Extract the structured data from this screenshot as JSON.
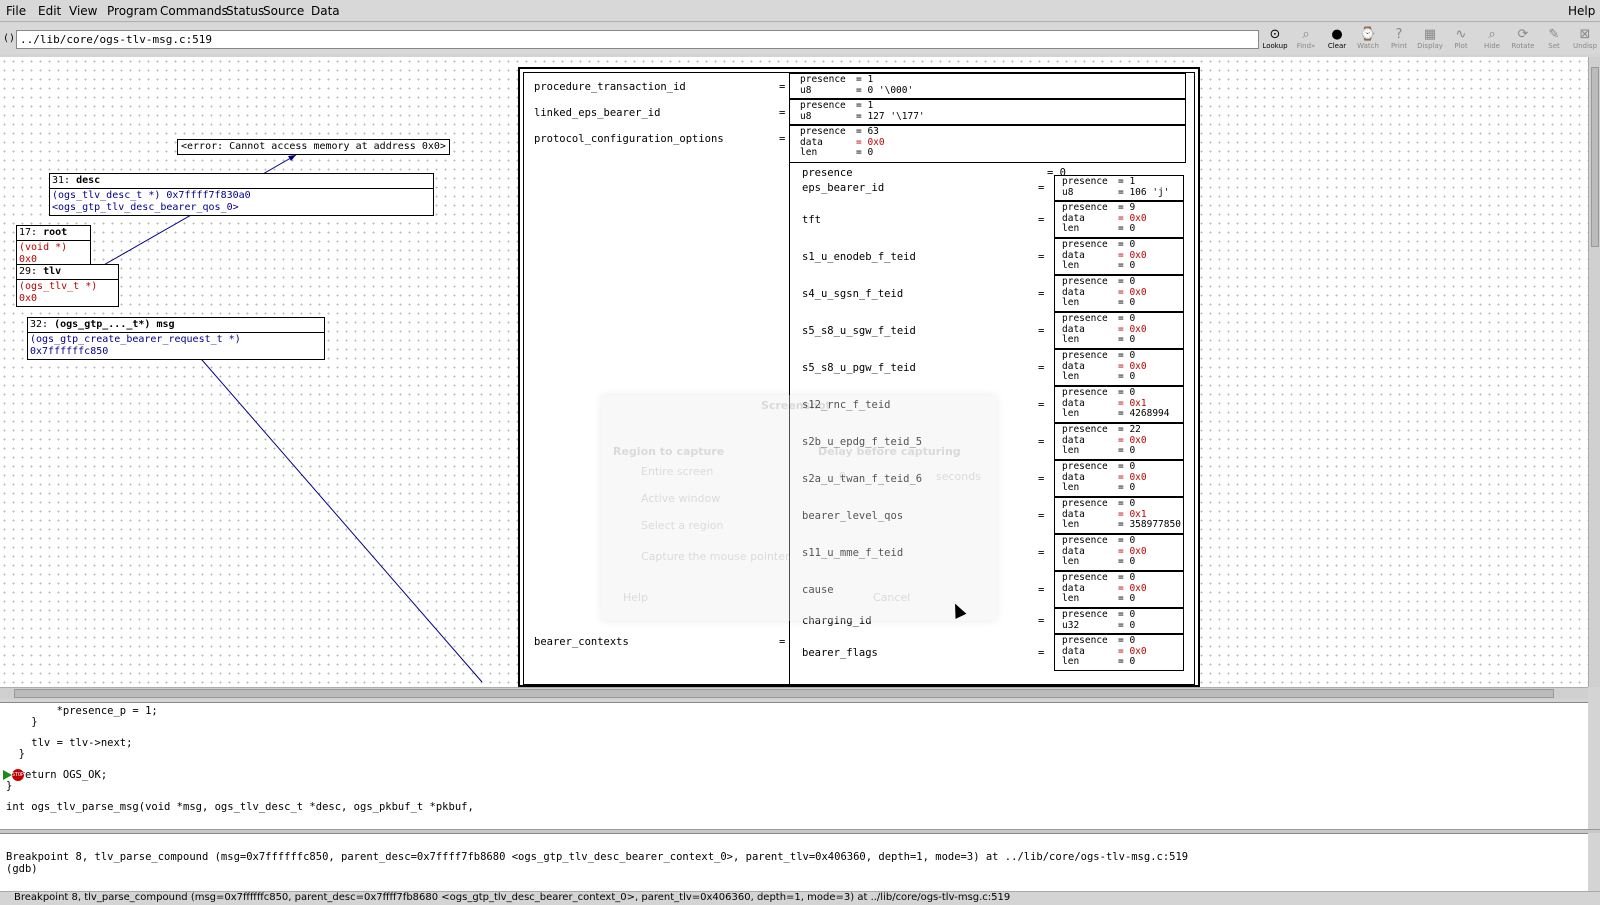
{
  "menu": [
    "File",
    "Edit",
    "View",
    "Program",
    "Commands",
    "Status",
    "Source",
    "Data"
  ],
  "help": "Help",
  "arg_label": "():",
  "arg_value": "../lib/core/ogs-tlv-msg.c:519",
  "toolbar": [
    {
      "label": "Lookup",
      "icon": "lookup-icon",
      "active": true
    },
    {
      "label": "Find»",
      "icon": "find-icon",
      "active": false
    },
    {
      "label": "Clear",
      "icon": "clear-icon",
      "active": true
    },
    {
      "label": "Watch",
      "icon": "watch-icon",
      "active": false
    },
    {
      "label": "Print",
      "icon": "print-icon",
      "active": false
    },
    {
      "label": "Display",
      "icon": "display-icon",
      "active": false
    },
    {
      "label": "Plot",
      "icon": "plot-icon",
      "active": false
    },
    {
      "label": "Hide",
      "icon": "hide-icon",
      "active": false
    },
    {
      "label": "Rotate",
      "icon": "rotate-icon",
      "active": false
    },
    {
      "label": "Set",
      "icon": "set-icon",
      "active": false
    },
    {
      "label": "Undisp",
      "icon": "undisp-icon",
      "active": false
    }
  ],
  "nodes": {
    "error": "<error: Cannot access memory at address 0x0>",
    "desc_hd_num": "31:",
    "desc_hd_name": "desc",
    "desc_val": "(ogs_tlv_desc_t *) 0x7ffff7f830a0 <ogs_gtp_tlv_desc_bearer_qos_0>",
    "root_hd_num": "17:",
    "root_hd_name": "root",
    "root_val": "(void *) 0x0",
    "tlv_hd_num": "29:",
    "tlv_hd_name": "tlv",
    "tlv_val": "(ogs_tlv_t *) 0x0",
    "msg_hd_num": "32:",
    "msg_hd_name": "(ogs_gtp_..._t*) msg",
    "msg_val": "(ogs_gtp_create_bearer_request_t *) 0x7ffffffc850"
  },
  "struct": {
    "top_fields": [
      {
        "name": "procedure_transaction_id",
        "lines": [
          [
            "presence",
            "= 1"
          ],
          [
            "u8",
            "= 0 '\\000'"
          ]
        ]
      },
      {
        "name": "linked_eps_bearer_id",
        "lines": [
          [
            "presence",
            "= 1"
          ],
          [
            "u8",
            "= 127 '\\177'"
          ]
        ]
      },
      {
        "name": "protocol_configuration_options",
        "lines": [
          [
            "presence",
            "= 63"
          ],
          [
            "data",
            "= 0x0"
          ],
          [
            "len",
            "= 0"
          ]
        ]
      }
    ],
    "bearer_label": "bearer_contexts",
    "eq": "=",
    "presence_label": "presence",
    "presence_val": "= 0",
    "sub": [
      {
        "name": "eps_bearer_id",
        "lines": [
          [
            "presence",
            "= 1"
          ],
          [
            "u8",
            "= 106 'j'"
          ]
        ]
      },
      {
        "name": "tft",
        "lines": [
          [
            "presence",
            "= 9"
          ],
          [
            "data",
            "= 0x0"
          ],
          [
            "len",
            "= 0"
          ]
        ]
      },
      {
        "name": "s1_u_enodeb_f_teid",
        "lines": [
          [
            "presence",
            "= 0"
          ],
          [
            "data",
            "= 0x0"
          ],
          [
            "len",
            "= 0"
          ]
        ]
      },
      {
        "name": "s4_u_sgsn_f_teid",
        "lines": [
          [
            "presence",
            "= 0"
          ],
          [
            "data",
            "= 0x0"
          ],
          [
            "len",
            "= 0"
          ]
        ]
      },
      {
        "name": "s5_s8_u_sgw_f_teid",
        "lines": [
          [
            "presence",
            "= 0"
          ],
          [
            "data",
            "= 0x0"
          ],
          [
            "len",
            "= 0"
          ]
        ]
      },
      {
        "name": "s5_s8_u_pgw_f_teid",
        "lines": [
          [
            "presence",
            "= 0"
          ],
          [
            "data",
            "= 0x0"
          ],
          [
            "len",
            "= 0"
          ]
        ]
      },
      {
        "name": "s12_rnc_f_teid",
        "lines": [
          [
            "presence",
            "= 0"
          ],
          [
            "data",
            "= 0x1"
          ],
          [
            "len",
            "= 4268994"
          ]
        ]
      },
      {
        "name": "s2b_u_epdg_f_teid_5",
        "lines": [
          [
            "presence",
            "= 22"
          ],
          [
            "data",
            "= 0x0"
          ],
          [
            "len",
            "= 0"
          ]
        ]
      },
      {
        "name": "s2a_u_twan_f_teid_6",
        "lines": [
          [
            "presence",
            "= 0"
          ],
          [
            "data",
            "= 0x0"
          ],
          [
            "len",
            "= 0"
          ]
        ]
      },
      {
        "name": "bearer_level_qos",
        "lines": [
          [
            "presence",
            "= 0"
          ],
          [
            "data",
            "= 0x1"
          ],
          [
            "len",
            "= 358977850"
          ]
        ]
      },
      {
        "name": "s11_u_mme_f_teid",
        "lines": [
          [
            "presence",
            "= 0"
          ],
          [
            "data",
            "= 0x0"
          ],
          [
            "len",
            "= 0"
          ]
        ]
      },
      {
        "name": "cause",
        "lines": [
          [
            "presence",
            "= 0"
          ],
          [
            "data",
            "= 0x0"
          ],
          [
            "len",
            "= 0"
          ]
        ]
      },
      {
        "name": "charging_id",
        "lines": [
          [
            "presence",
            "= 0"
          ],
          [
            "u32",
            "= 0"
          ]
        ]
      },
      {
        "name": "bearer_flags",
        "lines": [
          [
            "presence",
            "= 0"
          ],
          [
            "data",
            "= 0x0"
          ],
          [
            "len",
            "= 0"
          ]
        ]
      }
    ]
  },
  "ghost": {
    "title": "Screenshot",
    "region": "Region to capture",
    "entire": "Entire screen",
    "active": "Active window",
    "select": "Select a region",
    "capture": "Capture the mouse pointer",
    "delay": "Delay before capturing",
    "seconds": "seconds",
    "delay_val": "0",
    "help": "Help",
    "cancel": "Cancel"
  },
  "source": [
    "        *presence_p = 1;",
    "    }",
    "",
    "    tlv = tlv->next;",
    "  }",
    "",
    "  return OGS_OK;",
    "}",
    "",
    "int ogs_tlv_parse_msg(void *msg, ogs_tlv_desc_t *desc, ogs_pkbuf_t *pkbuf,"
  ],
  "console": [
    "Breakpoint 8, tlv_parse_compound (msg=0x7ffffffc850, parent_desc=0x7ffff7fb8680 <ogs_gtp_tlv_desc_bearer_context_0>, parent_tlv=0x406360, depth=1, mode=3) at ../lib/core/ogs-tlv-msg.c:519",
    "(gdb) "
  ],
  "status": "Breakpoint 8, tlv_parse_compound (msg=0x7ffffffc850, parent_desc=0x7ffff7fb8680 <ogs_gtp_tlv_desc_bearer_context_0>, parent_tlv=0x406360, depth=1, mode=3) at ../lib/core/ogs-tlv-msg.c:519"
}
